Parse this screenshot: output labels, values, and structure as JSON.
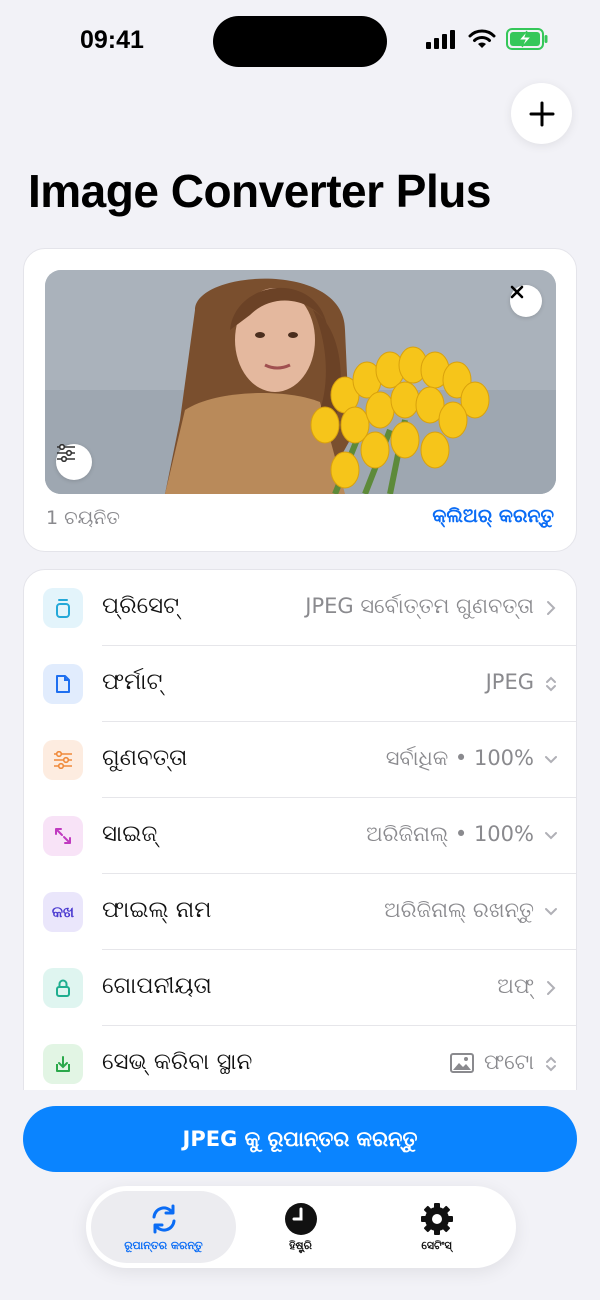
{
  "status": {
    "time": "09:41"
  },
  "app": {
    "title": "Image Converter Plus"
  },
  "image_card": {
    "selected_count": "1 ଚୟନିତ",
    "clear_label": "କ୍ଲିଅର୍ କରନ୍ତୁ"
  },
  "settings": [
    {
      "label": "ପ୍ରିସେଟ୍",
      "value": "JPEG ସର୍ବୋତ୍ତମ ଗୁଣବତ୍ତା",
      "icon": "preset-icon",
      "color": "#e3f4fb",
      "icon_color": "#24a8d8"
    },
    {
      "label": "ଫର୍ମାଟ୍",
      "value": "JPEG",
      "icon": "document-icon",
      "color": "#e1ecfd",
      "icon_color": "#1e6ff0"
    },
    {
      "label": "ଗୁଣବତ୍ତା",
      "value": "ସର୍ବାଧିକ • 100%",
      "icon": "sliders-icon",
      "color": "#fdece0",
      "icon_color": "#f08a3a"
    },
    {
      "label": "ସାଇଜ୍",
      "value": "ଅରିଜିନାଲ୍ • 100%",
      "icon": "resize-icon",
      "color": "#f8e3f7",
      "icon_color": "#c03ac0"
    },
    {
      "label": "ଫାଇଲ୍ ନାମ",
      "value": "ଅରିଜିନାଲ୍ ରଖନ୍ତୁ",
      "icon": "text-icon",
      "icon_text": "କଖ",
      "color": "#eae6fb",
      "icon_color": "#4a3ad0"
    },
    {
      "label": "ଗୋପନୀୟତା",
      "value": "ଅଫ୍",
      "icon": "lock-icon",
      "color": "#dff5f0",
      "icon_color": "#1fae8f"
    },
    {
      "label": "ସେଭ୍ କରିବା ସ୍ଥାନ",
      "value": "ଫଟୋ",
      "icon": "download-icon",
      "color": "#e2f5e4",
      "icon_color": "#2aa84a"
    }
  ],
  "convert_button": {
    "label": "JPEG କୁ ରୂପାନ୍ତର କରନ୍ତୁ"
  },
  "tabs": [
    {
      "label": "ରୂପାନ୍ତର କରନ୍ତୁ",
      "icon": "convert-icon",
      "active": true
    },
    {
      "label": "ହିଷ୍ଟ୍ରି",
      "icon": "clock-icon",
      "active": false
    },
    {
      "label": "ସେଟିଂସ୍",
      "icon": "gear-icon",
      "active": false
    }
  ],
  "colors": {
    "accent": "#0a84ff",
    "background": "#f2f2f7"
  }
}
